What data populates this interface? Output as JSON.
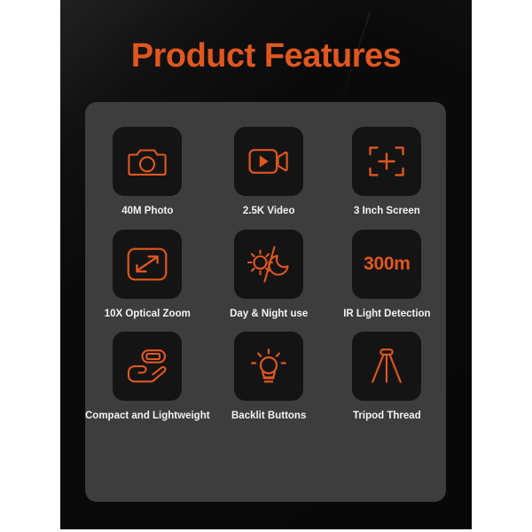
{
  "panel": {
    "title": "Product Features",
    "title_color": "#e0571f",
    "background_color": "#0a0a0a",
    "card_color": "#3d3d3d",
    "tile_color": "#141414",
    "label_color": "#f2f2f2"
  },
  "features": [
    {
      "label": "40M Photo",
      "icon": "camera-icon"
    },
    {
      "label": "2.5K Video",
      "icon": "video-camera-icon"
    },
    {
      "label": "3 Inch Screen",
      "icon": "screen-crosshair-icon"
    },
    {
      "label": "10X Optical Zoom",
      "icon": "expand-arrows-icon"
    },
    {
      "label": "Day & Night use",
      "icon": "sun-moon-icon"
    },
    {
      "label": "IR Light Detection",
      "icon": "distance-300m-text-icon",
      "icon_text": "300m"
    },
    {
      "label": "Compact and Lightweight",
      "icon": "hand-holding-device-icon"
    },
    {
      "label": "Backlit Buttons",
      "icon": "lightbulb-icon"
    },
    {
      "label": "Tripod Thread",
      "icon": "tripod-icon"
    }
  ]
}
